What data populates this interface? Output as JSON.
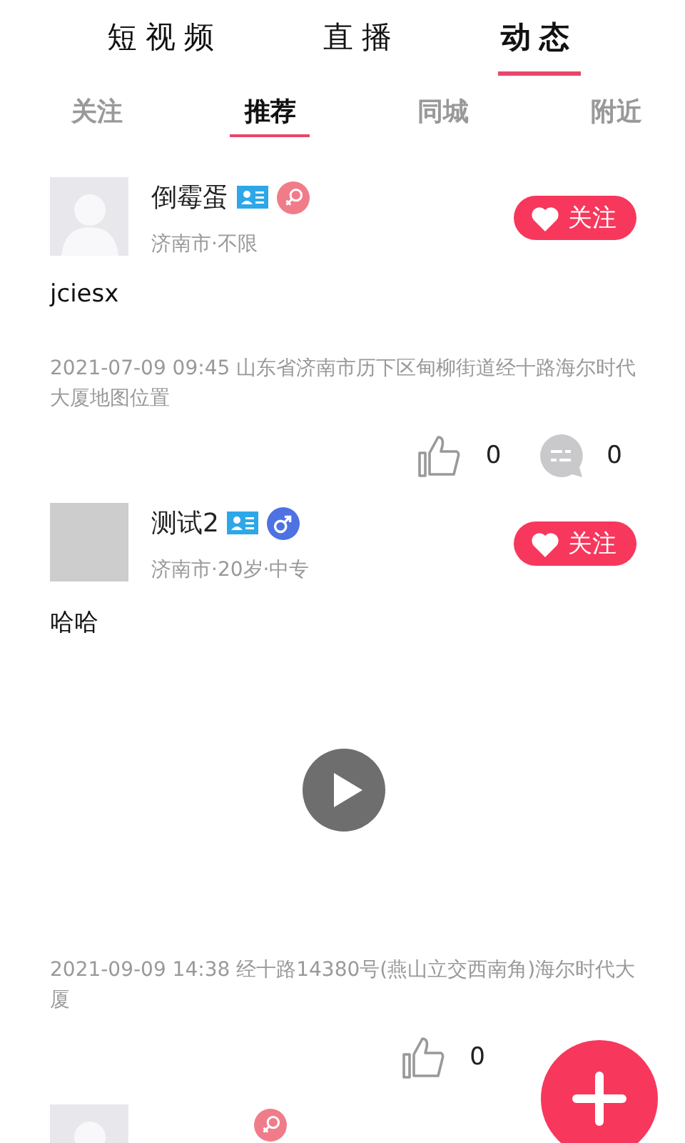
{
  "top_tabs": [
    {
      "label": "短视频",
      "selected": false
    },
    {
      "label": "直播",
      "selected": false
    },
    {
      "label": "动态",
      "selected": true
    }
  ],
  "sub_tabs": [
    {
      "label": "关注",
      "selected": false
    },
    {
      "label": "推荐",
      "selected": true
    },
    {
      "label": "同城",
      "selected": false
    },
    {
      "label": "附近",
      "selected": false
    }
  ],
  "posts": [
    {
      "avatar": {
        "kind": "silhouette"
      },
      "name": "倒霉蛋",
      "gender": {
        "kind": "female"
      },
      "info": "济南市·不限",
      "follow": "关注",
      "text": "jciesx",
      "video": false,
      "meta": "2021-07-09 09:45 山东省济南市历下区甸柳街道经十路海尔时代大厦地图位置",
      "likes": "0",
      "comments": "0"
    },
    {
      "avatar": {
        "kind": "blank"
      },
      "name": "测试2",
      "gender": {
        "kind": "male"
      },
      "info": "济南市·20岁·中专",
      "follow": "关注",
      "text": "哈哈",
      "video": true,
      "meta": "2021-09-09 14:38 经十路14380号(燕山立交西南角)海尔时代大厦",
      "likes": "0"
    },
    {
      "avatar": {
        "kind": "silhouette"
      },
      "gender": {
        "kind": "female"
      }
    }
  ]
}
